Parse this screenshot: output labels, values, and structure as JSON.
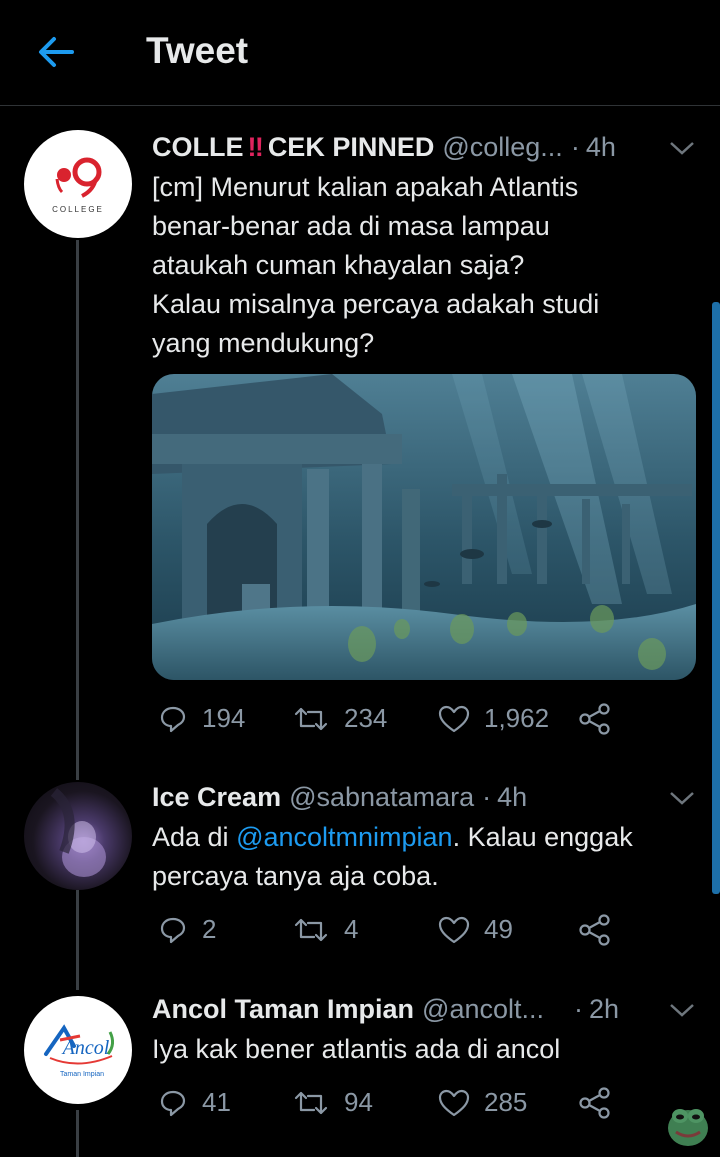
{
  "header": {
    "title": "Tweet"
  },
  "tweets": [
    {
      "name_a": "COLLE ",
      "name_b": "CEK PINNED",
      "handle": "@colleg...",
      "time": "4h",
      "lines": [
        "[cm] Menurut kalian apakah Atlantis",
        "benar-benar ada di masa lampau",
        "ataukah cuman khayalan saja?",
        "Kalau misalnya percaya adakah studi",
        "yang mendukung?"
      ],
      "avatar_label": "COLLEGE",
      "replies": "194",
      "retweets": "234",
      "likes": "1,962"
    },
    {
      "name": "Ice Cream",
      "handle": "@sabnatamara",
      "time": "4h",
      "text_pre": "Ada di ",
      "mention": "@ancoltmnimpian",
      "text_post": ". Kalau enggak",
      "line2": "percaya tanya aja coba.",
      "replies": "2",
      "retweets": "4",
      "likes": "49"
    },
    {
      "name": "Ancol Taman Impian",
      "handle": "@ancolt...",
      "time": "2h",
      "text": "Iya kak bener atlantis ada di ancol",
      "avatar_label": "Ancol",
      "avatar_sub": "Taman Impian",
      "replies": "41",
      "retweets": "94",
      "likes": "285"
    }
  ],
  "colors": {
    "accent": "#1d9bf0",
    "muted": "#8b98a5",
    "background": "#000000"
  }
}
